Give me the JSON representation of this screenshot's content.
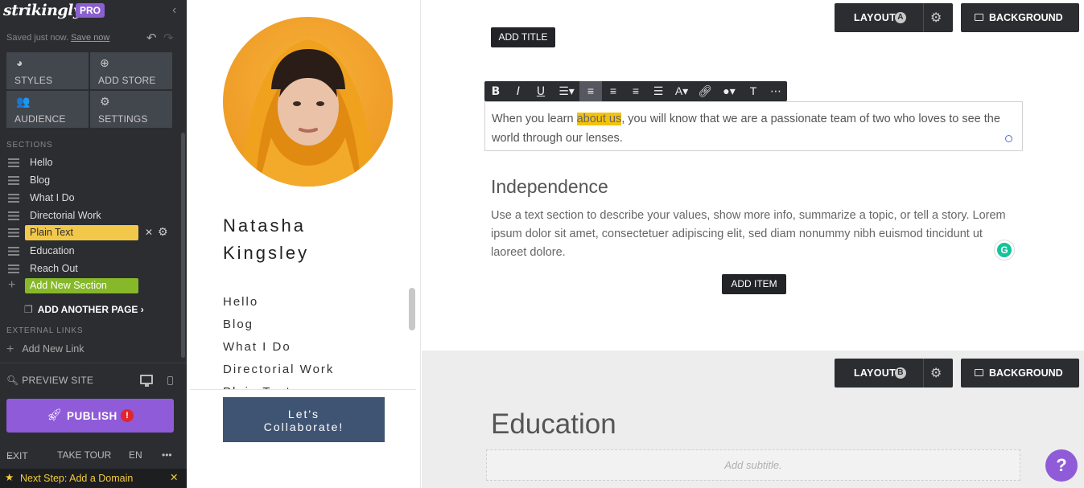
{
  "app": {
    "logo": "strikingly",
    "badge": "PRO",
    "saved_text": "Saved just now.",
    "save_now": "Save now"
  },
  "tools": [
    {
      "label": "STYLES",
      "icon": "palette-icon"
    },
    {
      "label": "ADD STORE",
      "icon": "store-icon"
    },
    {
      "label": "AUDIENCE",
      "icon": "people-icon"
    },
    {
      "label": "SETTINGS",
      "icon": "gear-icon"
    }
  ],
  "sidebar": {
    "sections_heading": "SECTIONS",
    "sections": [
      "Hello",
      "Blog",
      "What I Do",
      "Directorial Work",
      "Plain Text",
      "Education",
      "Reach Out"
    ],
    "add_section": "Add New Section",
    "add_page": "ADD ANOTHER PAGE",
    "external_heading": "EXTERNAL LINKS",
    "add_link": "Add New Link",
    "preview": "PREVIEW SITE",
    "publish": "PUBLISH",
    "publish_alert": "!",
    "exit": "EXIT",
    "tour": "TAKE TOUR",
    "lang": "EN",
    "more": "•••",
    "next_step": "Next Step: Add a Domain"
  },
  "site": {
    "name_first": "Natasha",
    "name_last": "Kingsley",
    "nav": [
      "Hello",
      "Blog",
      "What I Do",
      "Directorial Work",
      "Plain Text"
    ],
    "cta_line1": "Let's",
    "cta_line2": "Collaborate!"
  },
  "editor": {
    "layout_label": "LAYOUT",
    "layout_a": "A",
    "layout_b": "B",
    "background_label": "BACKGROUND",
    "add_title": "ADD TITLE",
    "text_before": "When you learn ",
    "text_highlight": "about us",
    "text_after": ", you will know that we are a passionate team of two who loves to see the world through our lenses.",
    "heading": "Independence",
    "body": "Use a text section to describe your values, show more info, summarize a topic, or tell a story. Lorem ipsum dolor sit amet, consectetuer adipiscing elit, sed diam nonummy nibh euismod tincidunt ut laoreet dolore.",
    "add_item": "ADD ITEM",
    "edu_heading": "Education",
    "subtitle_placeholder": "Add subtitle.",
    "help": "?"
  },
  "colors": {
    "sidebar_bg": "#2b2d30",
    "active_section": "#f2c84b",
    "add_section": "#86b82a",
    "publish": "#8f5bd8",
    "highlight": "#f4c20d",
    "cta": "#3f5473"
  }
}
